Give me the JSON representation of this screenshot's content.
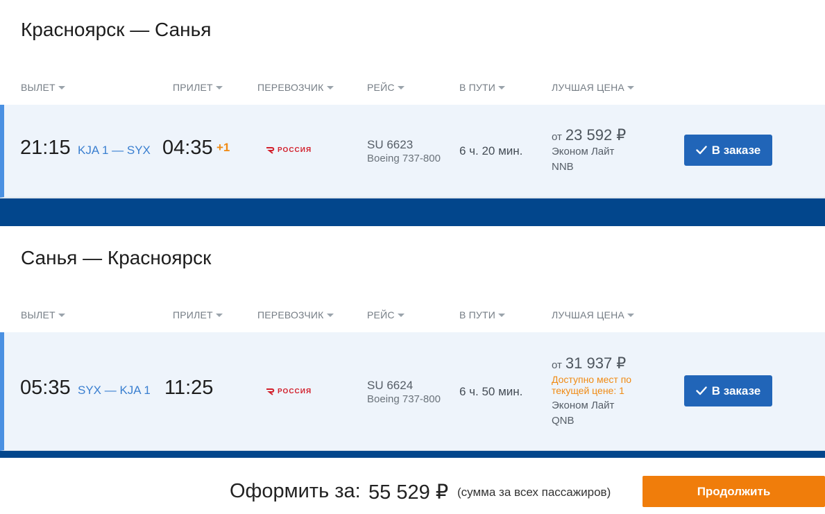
{
  "columns": {
    "departure": "ВЫЛЕТ",
    "arrival": "ПРИЛЕТ",
    "carrier": "ПЕРЕВОЗЧИК",
    "flight": "РЕЙС",
    "duration": "В ПУТИ",
    "best_price": "ЛУЧШАЯ ЦЕНА"
  },
  "outbound": {
    "title": "Красноярск — Санья",
    "flight": {
      "departure_time": "21:15",
      "route": "KJA 1 — SYX",
      "arrival_time": "04:35",
      "day_offset": "+1",
      "carrier_logo_text": "РОССИЯ",
      "flight_number": "SU 6623",
      "aircraft": "Boeing 737-800",
      "duration": "6 ч. 20 мин.",
      "price_prefix": "от",
      "price": "23 592 ₽",
      "fare": "Эконом Лайт",
      "fare_code": "NNB",
      "button_label": "В заказе"
    }
  },
  "inbound": {
    "title": "Санья — Красноярск",
    "flight": {
      "departure_time": "05:35",
      "route": "SYX — KJA 1",
      "arrival_time": "11:25",
      "carrier_logo_text": "РОССИЯ",
      "flight_number": "SU 6624",
      "aircraft": "Boeing 737-800",
      "duration": "6 ч. 50 мин.",
      "price_prefix": "от",
      "price": "31 937 ₽",
      "availability": "Доступно мест по текущей цене: 1",
      "fare": "Эконом Лайт",
      "fare_code": "QNB",
      "button_label": "В заказе"
    }
  },
  "footer": {
    "total_label": "Оформить за:",
    "total_value": "55 529 ₽",
    "total_note": "(сумма за всех пассажиров)",
    "continue_label": "Продолжить"
  },
  "colors": {
    "accent_blue": "#2165b8",
    "band_blue": "#02468c",
    "orange": "#f07d0b",
    "row_bg": "#eef4fb",
    "airline_red": "#d21f2b"
  }
}
